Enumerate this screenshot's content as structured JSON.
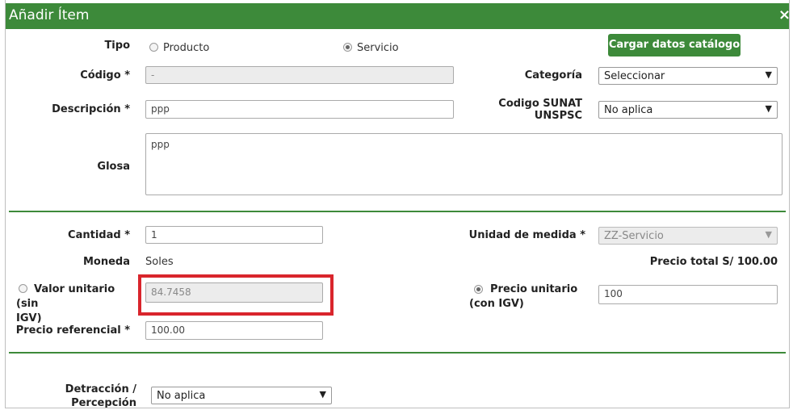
{
  "dialog": {
    "title": "Añadir Ítem",
    "close_glyph": "×"
  },
  "tipo": {
    "label": "Tipo",
    "option_producto": "Producto",
    "option_servicio": "Servicio",
    "selected": "Servicio"
  },
  "catalog_button": "Cargar datos catálogo",
  "codigo": {
    "label": "Código *",
    "value": "-"
  },
  "categoria": {
    "label": "Categoría",
    "value": "Seleccionar"
  },
  "descripcion": {
    "label": "Descripción *",
    "value": "ppp"
  },
  "codigo_sunat": {
    "label_line1": "Codigo SUNAT",
    "label_line2": "UNSPSC",
    "value": "No aplica"
  },
  "glosa": {
    "label": "Glosa",
    "value": "ppp"
  },
  "cantidad": {
    "label": "Cantidad *",
    "value": "1"
  },
  "unidad": {
    "label": "Unidad de medida *",
    "value": "ZZ-Servicio"
  },
  "moneda": {
    "label": "Moneda",
    "value": "Soles"
  },
  "precio_total": "Precio total S/ 100.00",
  "valor_unitario": {
    "label_line1": "Valor unitario (sin",
    "label_line2": "IGV)",
    "value": "84.7458"
  },
  "precio_unitario": {
    "label_line1": "Precio unitario",
    "label_line2": "(con IGV)",
    "value": "100"
  },
  "precio_referencial": {
    "label": "Precio referencial *",
    "value": "100.00"
  },
  "detraccion": {
    "label_line1": "Detracción /",
    "label_line2": "Percepción",
    "value": "No aplica"
  },
  "colors": {
    "header_green": "#3d8a3a",
    "highlight_red": "#d9252c"
  },
  "icons": {
    "dropdown": "chevron-down-icon",
    "close": "close-icon"
  }
}
